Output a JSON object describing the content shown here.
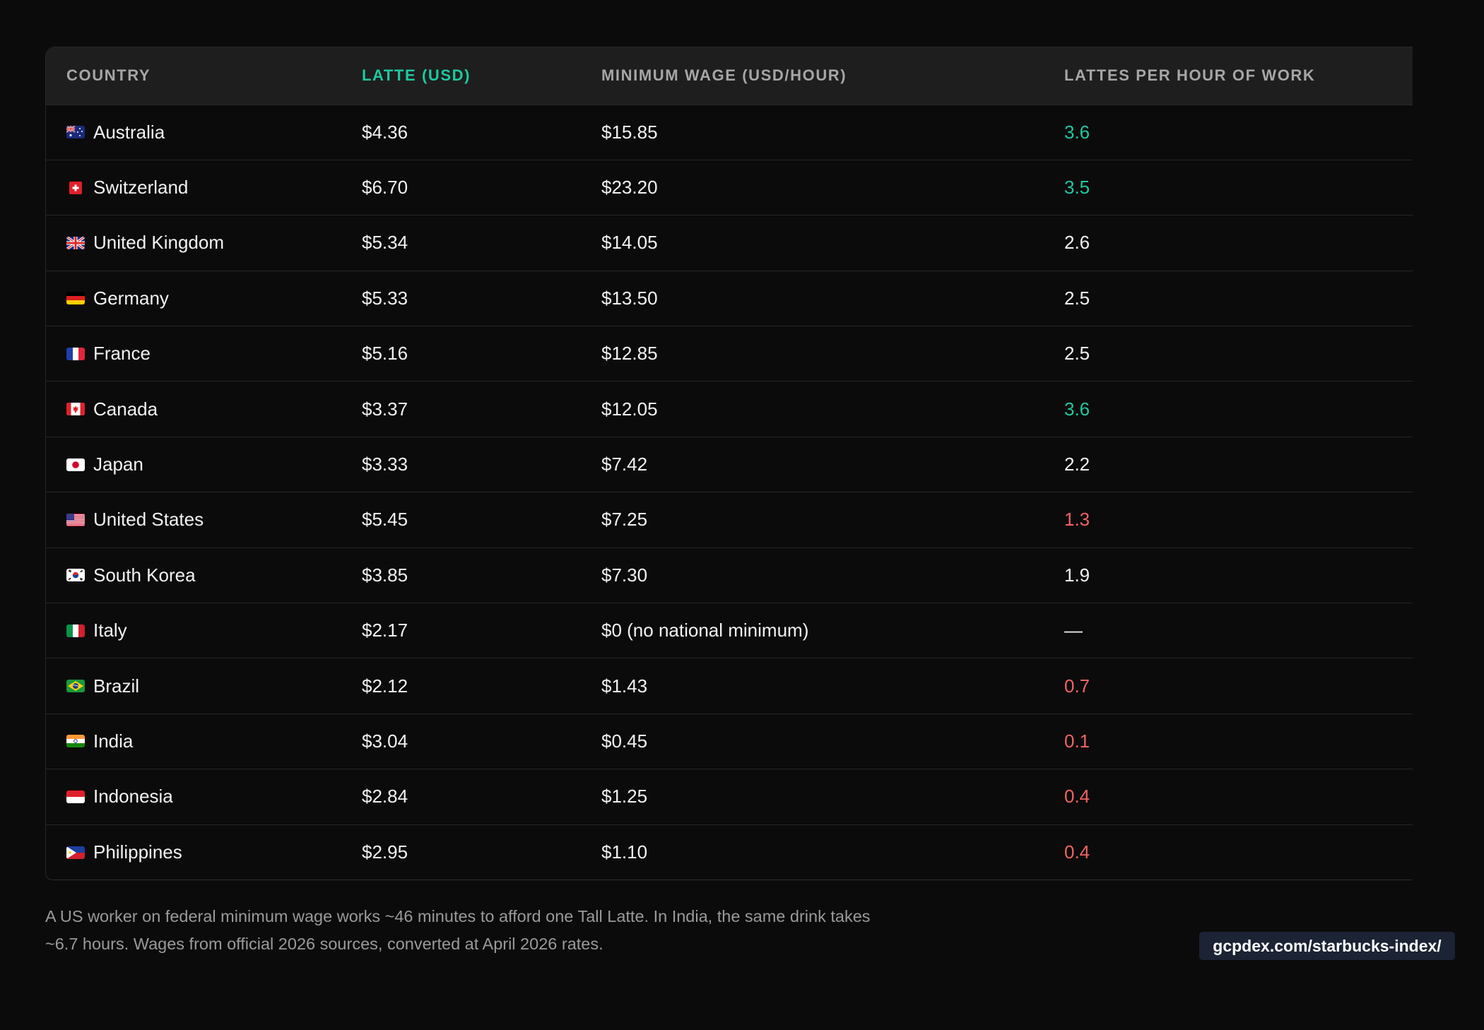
{
  "table": {
    "headers": {
      "country": "COUNTRY",
      "latte": "LATTE (USD)",
      "wage": "MINIMUM WAGE (USD/HOUR)",
      "lattes_per_hour": "LATTES PER HOUR OF WORK"
    },
    "rows": [
      {
        "country": "Australia",
        "flag": "australia-flag",
        "latte": "$4.36",
        "wage": "$15.85",
        "lph": "3.6",
        "tone": "good"
      },
      {
        "country": "Switzerland",
        "flag": "switzerland-flag",
        "latte": "$6.70",
        "wage": "$23.20",
        "lph": "3.5",
        "tone": "good"
      },
      {
        "country": "United Kingdom",
        "flag": "united-kingdom-flag",
        "latte": "$5.34",
        "wage": "$14.05",
        "lph": "2.6",
        "tone": "neutral"
      },
      {
        "country": "Germany",
        "flag": "germany-flag",
        "latte": "$5.33",
        "wage": "$13.50",
        "lph": "2.5",
        "tone": "neutral"
      },
      {
        "country": "France",
        "flag": "france-flag",
        "latte": "$5.16",
        "wage": "$12.85",
        "lph": "2.5",
        "tone": "neutral"
      },
      {
        "country": "Canada",
        "flag": "canada-flag",
        "latte": "$3.37",
        "wage": "$12.05",
        "lph": "3.6",
        "tone": "good"
      },
      {
        "country": "Japan",
        "flag": "japan-flag",
        "latte": "$3.33",
        "wage": "$7.42",
        "lph": "2.2",
        "tone": "neutral"
      },
      {
        "country": "United States",
        "flag": "united-states-flag",
        "latte": "$5.45",
        "wage": "$7.25",
        "lph": "1.3",
        "tone": "bad"
      },
      {
        "country": "South Korea",
        "flag": "south-korea-flag",
        "latte": "$3.85",
        "wage": "$7.30",
        "lph": "1.9",
        "tone": "neutral"
      },
      {
        "country": "Italy",
        "flag": "italy-flag",
        "latte": "$2.17",
        "wage": "$0 (no national minimum)",
        "lph": "—",
        "tone": "neutral"
      },
      {
        "country": "Brazil",
        "flag": "brazil-flag",
        "latte": "$2.12",
        "wage": "$1.43",
        "lph": "0.7",
        "tone": "bad"
      },
      {
        "country": "India",
        "flag": "india-flag",
        "latte": "$3.04",
        "wage": "$0.45",
        "lph": "0.1",
        "tone": "bad"
      },
      {
        "country": "Indonesia",
        "flag": "indonesia-flag",
        "latte": "$2.84",
        "wage": "$1.25",
        "lph": "0.4",
        "tone": "bad"
      },
      {
        "country": "Philippines",
        "flag": "philippines-flag",
        "latte": "$2.95",
        "wage": "$1.10",
        "lph": "0.4",
        "tone": "bad"
      }
    ]
  },
  "footnote": {
    "line1": "A US worker on federal minimum wage works ~46 minutes to afford one Tall Latte. In India, the same drink takes",
    "line2": "~6.7 hours. Wages from official 2026 sources, converted at April 2026 rates."
  },
  "source_badge": "gcpdex.com/starbucks-index/",
  "colors": {
    "background": "#0b0b0b",
    "header_bg": "#1e1e1e",
    "accent_good": "#1fc8a0",
    "accent_bad": "#f26363",
    "badge_bg": "#1b2334"
  }
}
